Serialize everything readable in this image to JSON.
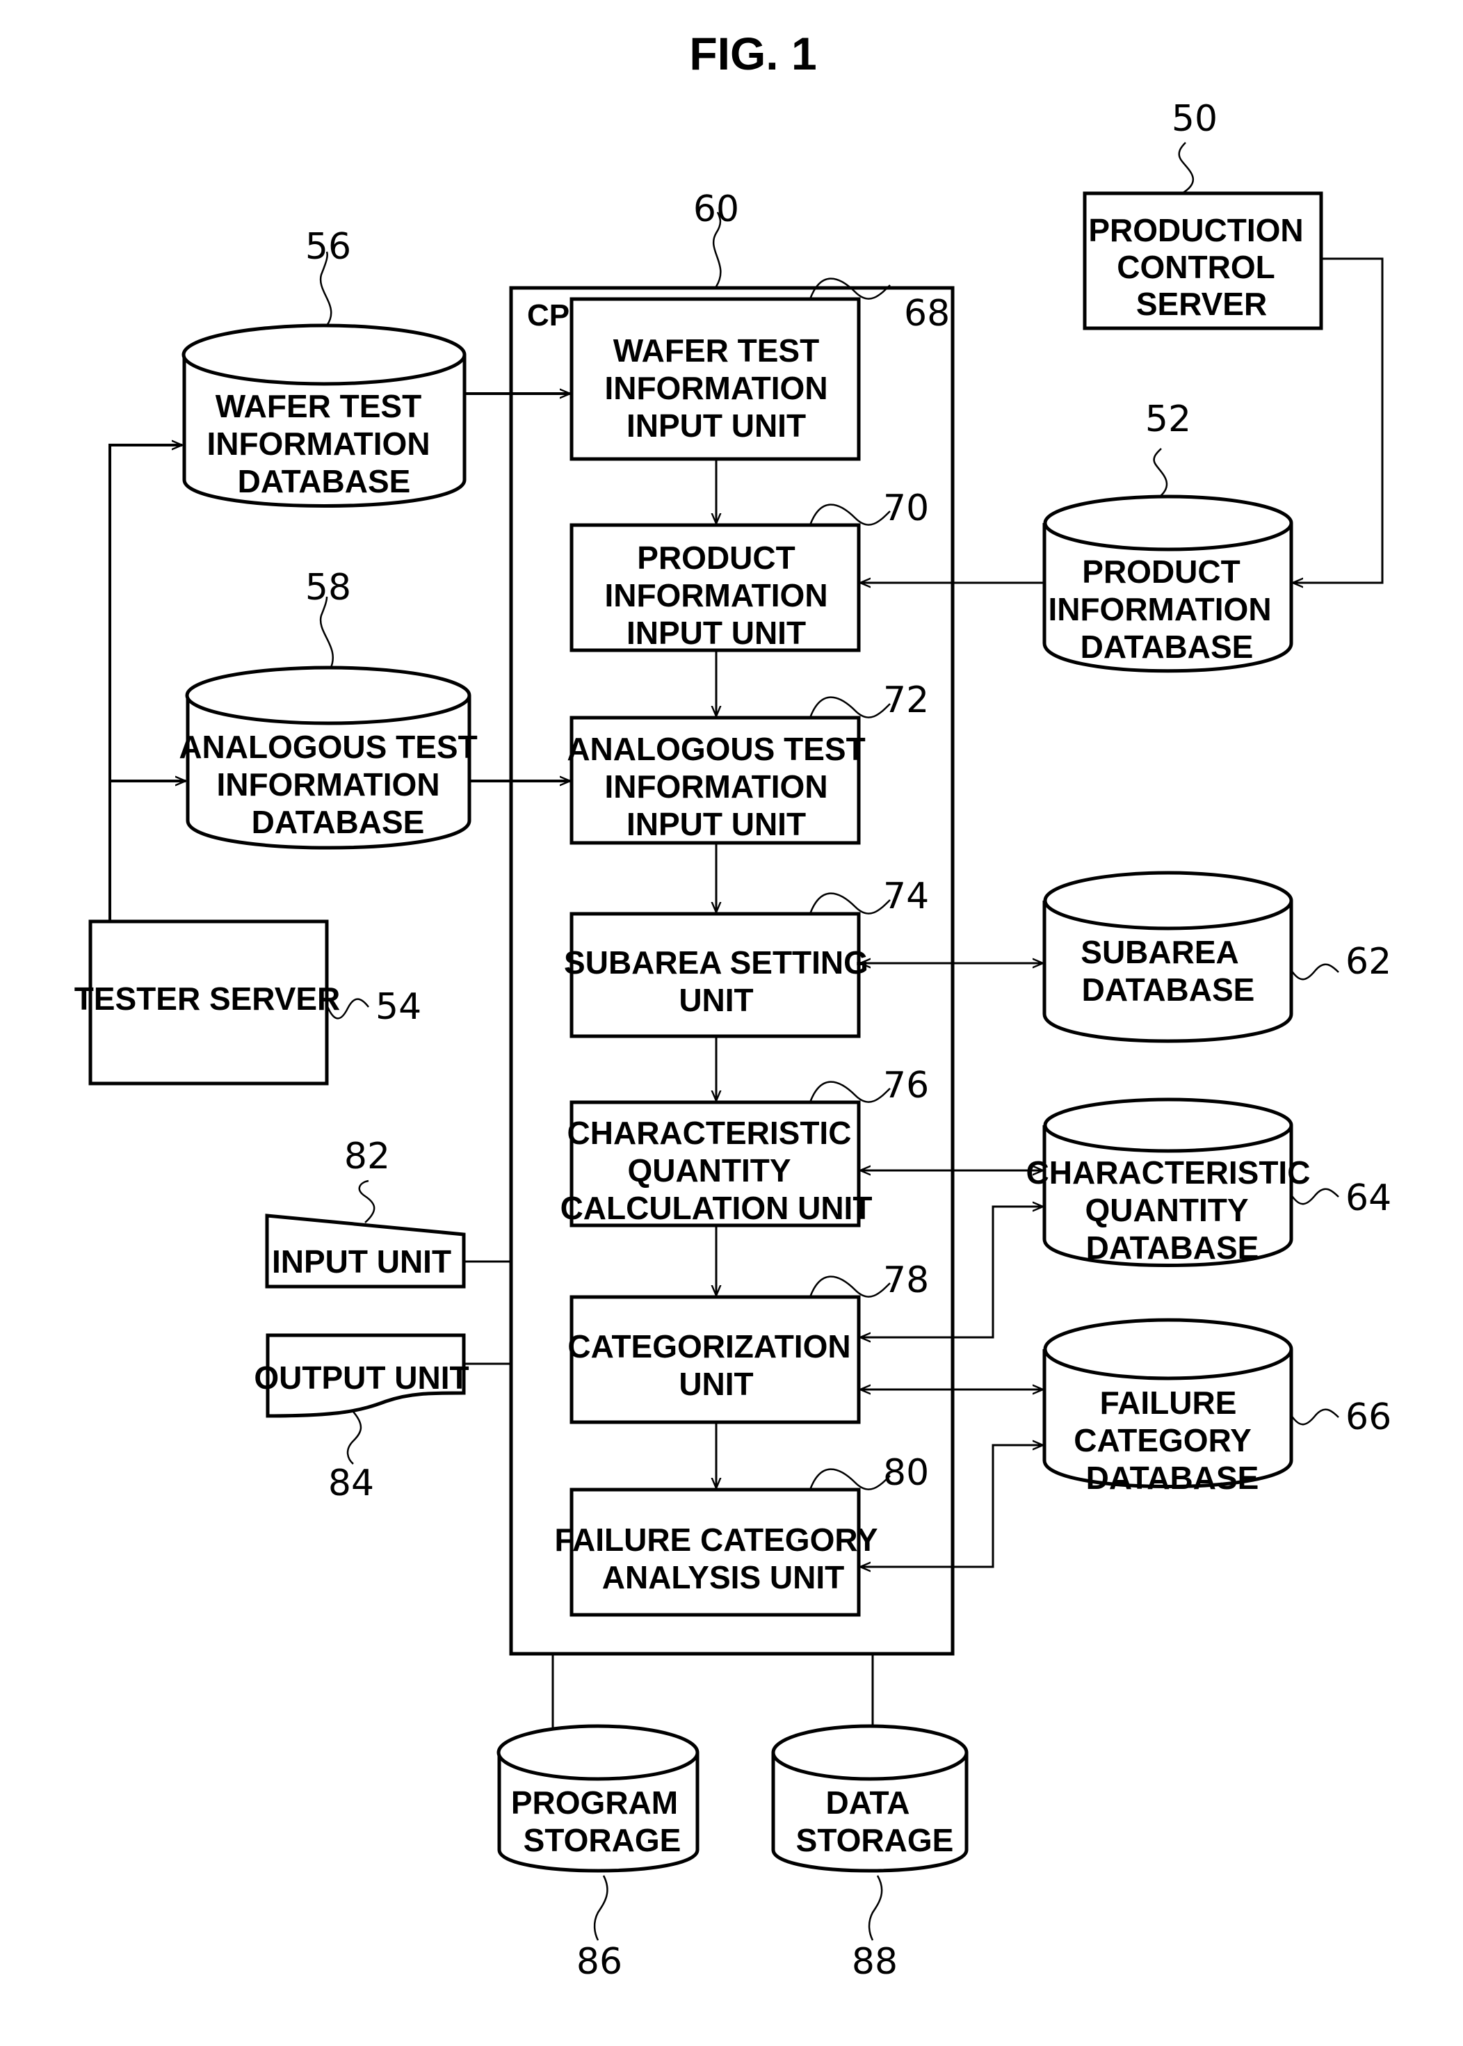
{
  "figure": {
    "title": "FIG. 1"
  },
  "cpu": {
    "ref": "60",
    "label": "CPU"
  },
  "units": [
    {
      "ref": "68",
      "lines": [
        "WAFER TEST",
        "INFORMATION",
        "INPUT UNIT"
      ]
    },
    {
      "ref": "70",
      "lines": [
        "PRODUCT",
        "INFORMATION",
        "INPUT UNIT"
      ]
    },
    {
      "ref": "72",
      "lines": [
        "ANALOGOUS TEST",
        "INFORMATION",
        "INPUT UNIT"
      ]
    },
    {
      "ref": "74",
      "lines": [
        "SUBAREA SETTING",
        "UNIT"
      ]
    },
    {
      "ref": "76",
      "lines": [
        "CHARACTERISTIC",
        "QUANTITY",
        "CALCULATION UNIT"
      ]
    },
    {
      "ref": "78",
      "lines": [
        "CATEGORIZATION",
        "UNIT"
      ]
    },
    {
      "ref": "80",
      "lines": [
        "FAILURE CATEGORY",
        "ANALYSIS UNIT"
      ]
    }
  ],
  "databases": {
    "wafer_test": {
      "ref": "56",
      "lines": [
        "WAFER TEST",
        "INFORMATION",
        "DATABASE"
      ]
    },
    "analogous_test": {
      "ref": "58",
      "lines": [
        "ANALOGOUS TEST",
        "INFORMATION",
        "DATABASE"
      ]
    },
    "product_info": {
      "ref": "52",
      "lines": [
        "PRODUCT",
        "INFORMATION",
        "DATABASE"
      ]
    },
    "subarea": {
      "ref": "62",
      "lines": [
        "SUBAREA",
        "DATABASE"
      ]
    },
    "characteristic_quantity": {
      "ref": "64",
      "lines": [
        "CHARACTERISTIC",
        "QUANTITY",
        "DATABASE"
      ]
    },
    "failure_category": {
      "ref": "66",
      "lines": [
        "FAILURE",
        "CATEGORY",
        "DATABASE"
      ]
    },
    "program_storage": {
      "ref": "86",
      "lines": [
        "PROGRAM",
        "STORAGE"
      ]
    },
    "data_storage": {
      "ref": "88",
      "lines": [
        "DATA",
        "STORAGE"
      ]
    }
  },
  "servers": {
    "production_control": {
      "ref": "50",
      "lines": [
        "PRODUCTION",
        "CONTROL",
        "SERVER"
      ]
    },
    "tester": {
      "ref": "54",
      "lines": [
        "TESTER SERVER"
      ]
    }
  },
  "io": {
    "input_unit": {
      "ref": "82",
      "label": "INPUT UNIT"
    },
    "output_unit": {
      "ref": "84",
      "label": "OUTPUT UNIT"
    }
  }
}
